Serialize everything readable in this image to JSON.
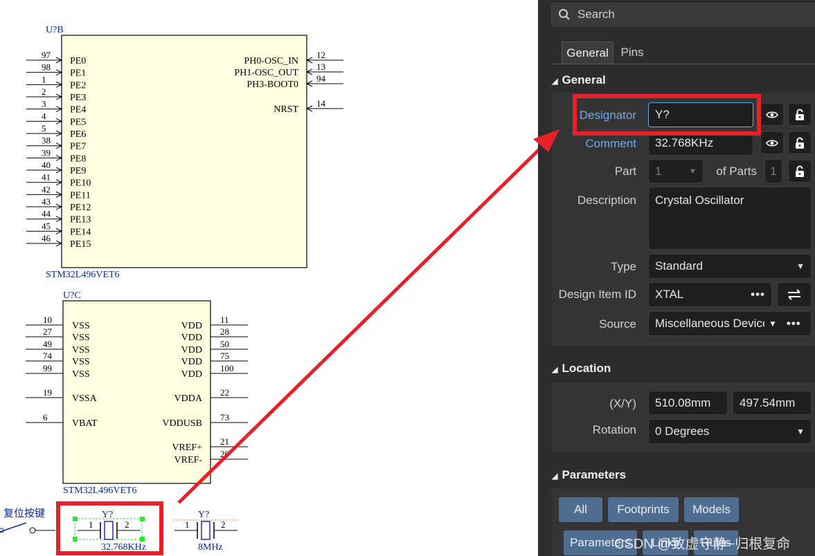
{
  "schematic": {
    "u_b": {
      "designator": "U?B",
      "part": "STM32L496VET6",
      "left_pins": [
        {
          "num": "97",
          "name": "PE0"
        },
        {
          "num": "98",
          "name": "PE1"
        },
        {
          "num": "1",
          "name": "PE2"
        },
        {
          "num": "2",
          "name": "PE3"
        },
        {
          "num": "3",
          "name": "PE4"
        },
        {
          "num": "4",
          "name": "PE5"
        },
        {
          "num": "5",
          "name": "PE6"
        },
        {
          "num": "38",
          "name": "PE7"
        },
        {
          "num": "39",
          "name": "PE8"
        },
        {
          "num": "40",
          "name": "PE9"
        },
        {
          "num": "41",
          "name": "PE10"
        },
        {
          "num": "42",
          "name": "PE11"
        },
        {
          "num": "43",
          "name": "PE12"
        },
        {
          "num": "44",
          "name": "PE13"
        },
        {
          "num": "45",
          "name": "PE14"
        },
        {
          "num": "46",
          "name": "PE15"
        }
      ],
      "right_pins": [
        {
          "num": "12",
          "name": "PH0-OSC_IN"
        },
        {
          "num": "13",
          "name": "PH1-OSC_OUT"
        },
        {
          "num": "94",
          "name": "PH3-BOOT0"
        },
        {
          "num": "14",
          "name": "NRST"
        }
      ]
    },
    "u_c": {
      "designator": "U?C",
      "part": "STM32L496VET6",
      "left_pins": [
        {
          "num": "10",
          "name": "VSS"
        },
        {
          "num": "27",
          "name": "VSS"
        },
        {
          "num": "49",
          "name": "VSS"
        },
        {
          "num": "74",
          "name": "VSS"
        },
        {
          "num": "99",
          "name": "VSS"
        },
        {
          "num": "19",
          "name": "VSSA"
        },
        {
          "num": "6",
          "name": "VBAT"
        }
      ],
      "right_pins": [
        {
          "num": "11",
          "name": "VDD"
        },
        {
          "num": "28",
          "name": "VDD"
        },
        {
          "num": "50",
          "name": "VDD"
        },
        {
          "num": "75",
          "name": "VDD"
        },
        {
          "num": "100",
          "name": "VDD"
        },
        {
          "num": "22",
          "name": "VDDA"
        },
        {
          "num": "73",
          "name": "VDDUSB"
        },
        {
          "num": "21",
          "name": "VREF+"
        },
        {
          "num": "20",
          "name": "VREF-"
        }
      ]
    },
    "reset_label": "复位按键",
    "crystal1": {
      "designator": "Y?",
      "value": "32.768KHz",
      "pin1": "1",
      "pin2": "2"
    },
    "crystal2": {
      "designator": "Y?",
      "value": "8MHz",
      "pin1": "1",
      "pin2": "2"
    }
  },
  "panel": {
    "search_placeholder": "Search",
    "tabs": [
      {
        "label": "General"
      },
      {
        "label": "Pins"
      }
    ],
    "general": {
      "title": "General",
      "designator_label": "Designator",
      "designator_value": "Y?",
      "comment_label": "Comment",
      "comment_value": "32.768KHz",
      "part_label": "Part",
      "part_value": "1",
      "of_parts_label": "of Parts",
      "of_parts_value": "1",
      "description_label": "Description",
      "description_value": "Crystal Oscillator",
      "type_label": "Type",
      "type_value": "Standard",
      "design_item_label": "Design Item ID",
      "design_item_value": "XTAL",
      "source_label": "Source",
      "source_value": "Miscellaneous Device"
    },
    "location": {
      "title": "Location",
      "xy_label": "(X/Y)",
      "x_value": "510.08mm",
      "y_value": "497.54mm",
      "rotation_label": "Rotation",
      "rotation_value": "0 Degrees"
    },
    "parameters": {
      "title": "Parameters",
      "buttons": [
        "All",
        "Footprints",
        "Models",
        "Parameters",
        "Links",
        "Rules"
      ]
    }
  },
  "watermark": "CSDN @致虚守静~归根复命",
  "colors": {
    "highlight": "#e8202a",
    "panel_bg": "#2d2d2d",
    "component_fill": "#ffffe1",
    "accent_blue": "#6fa8e8"
  }
}
